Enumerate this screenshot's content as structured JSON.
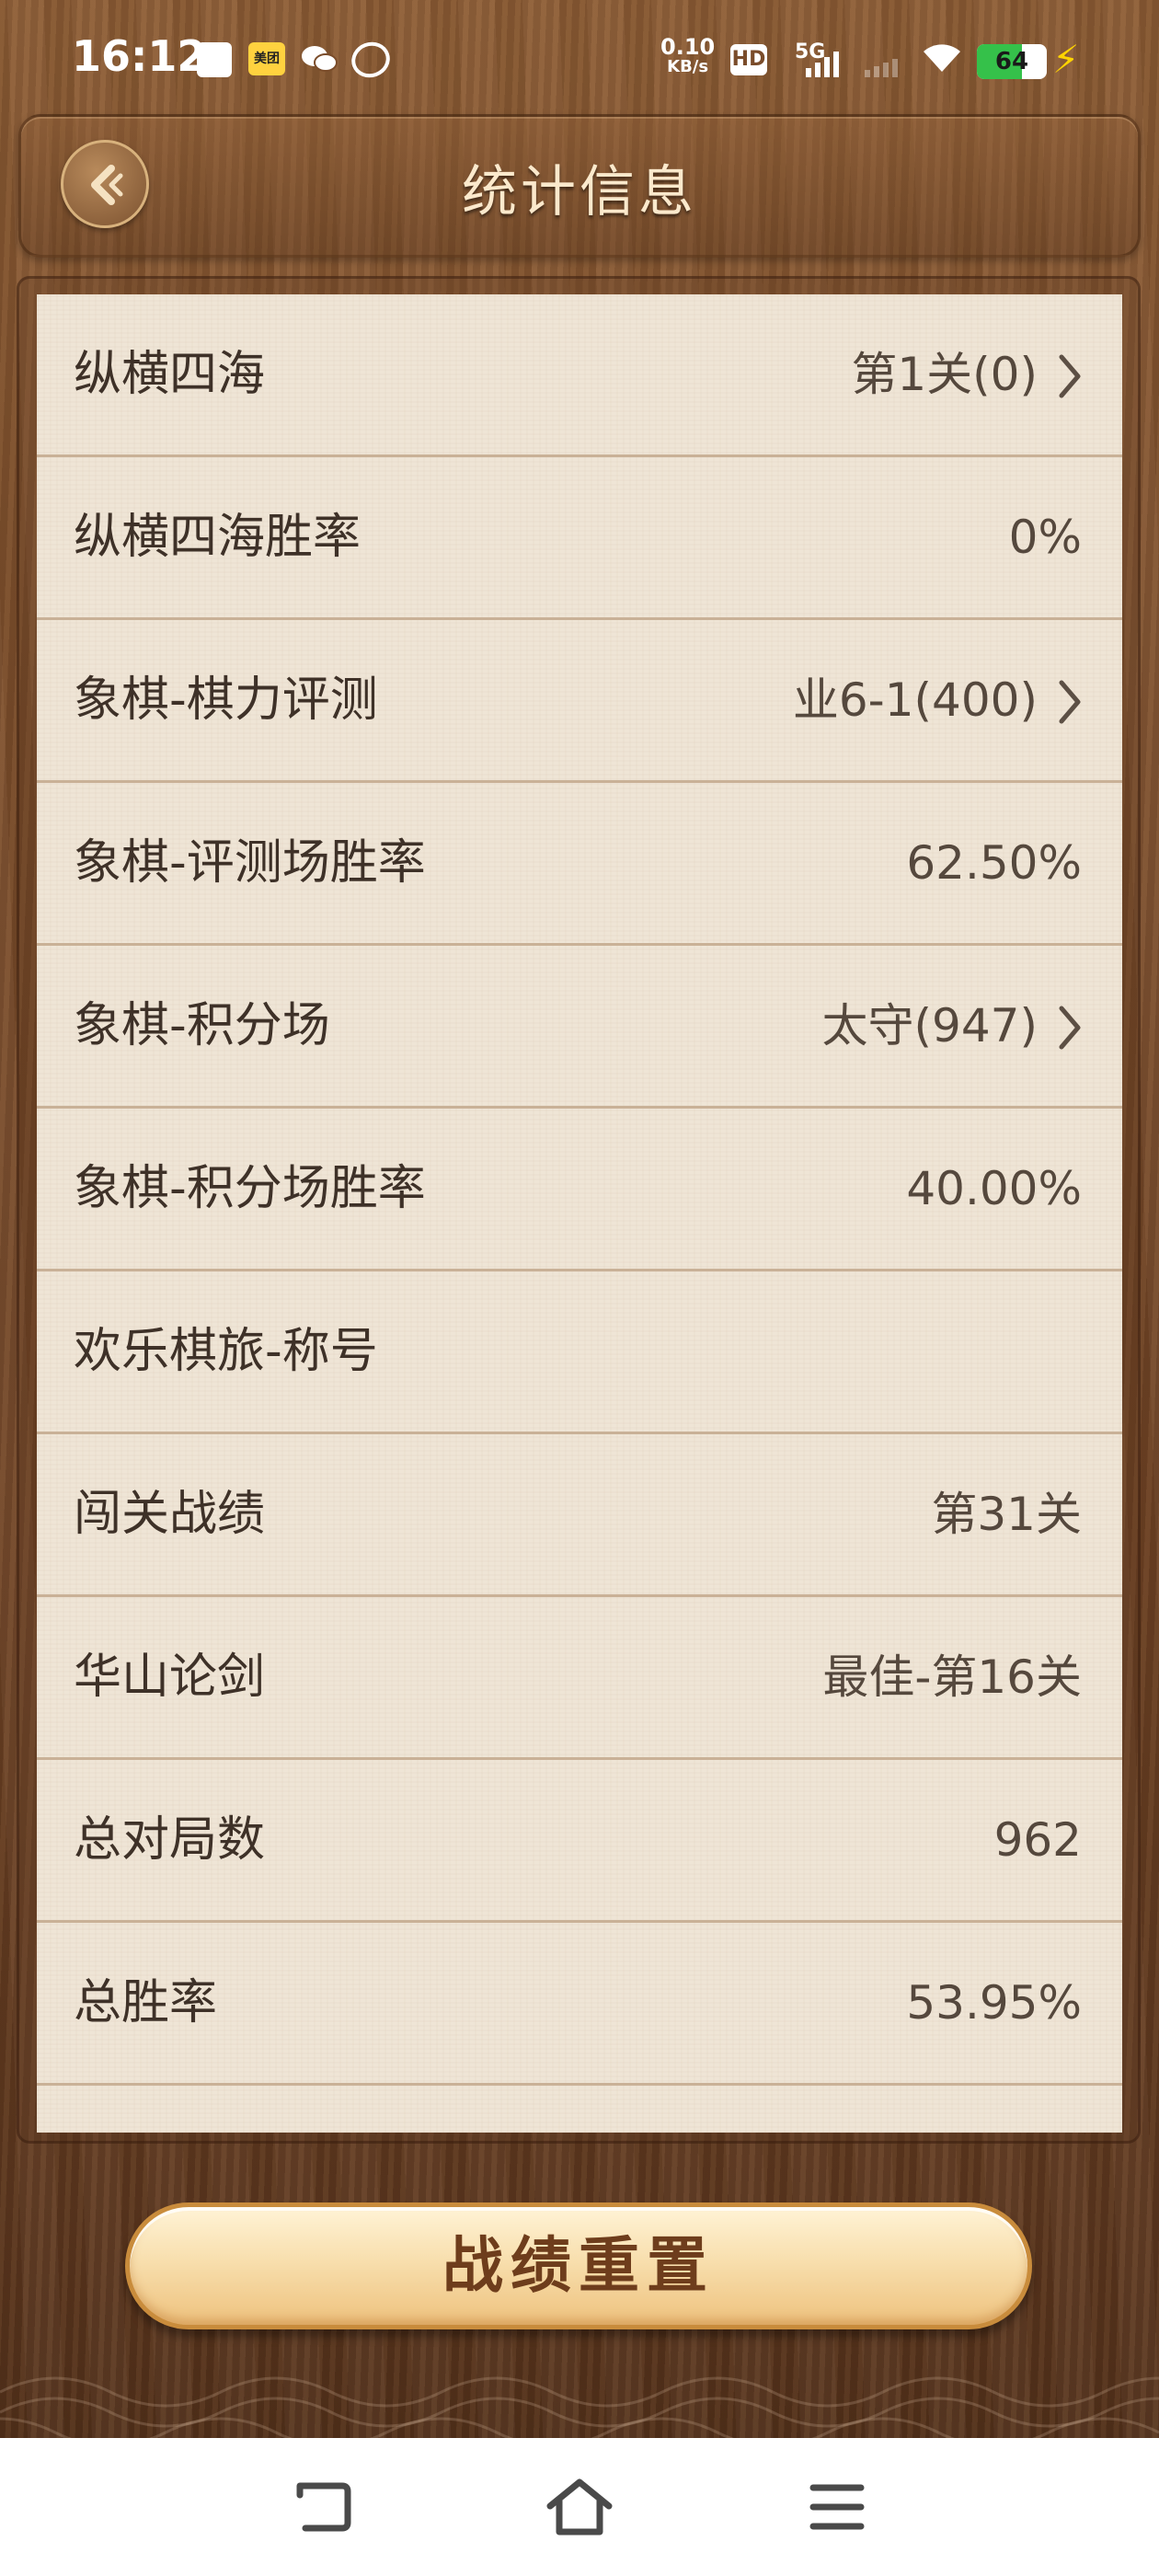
{
  "status_bar": {
    "time": "16:12",
    "net_speed_value": "0.10",
    "net_speed_unit": "KB/s",
    "hd_label": "HD",
    "network_type": "5G",
    "battery_level": "64",
    "battery_fraction": 0.64,
    "app_icons": [
      "white-square-icon",
      "meituan-icon",
      "wechat-icon",
      "browser-icon"
    ],
    "meituan_label": "美团"
  },
  "header": {
    "title": "统计信息",
    "back_icon": "back-arrow-icon"
  },
  "stats": [
    {
      "label": "纵横四海",
      "value": "第1关(0)",
      "has_arrow": true
    },
    {
      "label": "纵横四海胜率",
      "value": "0%",
      "has_arrow": false
    },
    {
      "label": "象棋-棋力评测",
      "value": "业6-1(400)",
      "has_arrow": true
    },
    {
      "label": "象棋-评测场胜率",
      "value": "62.50%",
      "has_arrow": false
    },
    {
      "label": "象棋-积分场",
      "value": "太守(947)",
      "has_arrow": true
    },
    {
      "label": "象棋-积分场胜率",
      "value": "40.00%",
      "has_arrow": false
    },
    {
      "label": "欢乐棋旅-称号",
      "value": "",
      "has_arrow": false
    },
    {
      "label": "闯关战绩",
      "value": "第31关",
      "has_arrow": false
    },
    {
      "label": "华山论剑",
      "value": "最佳-第16关",
      "has_arrow": false
    },
    {
      "label": "总对局数",
      "value": "962",
      "has_arrow": false
    },
    {
      "label": "总胜率",
      "value": "53.95%",
      "has_arrow": false
    }
  ],
  "reset_button": {
    "label": "战绩重置"
  },
  "nav_bar": {
    "icons": [
      "back-nav-icon",
      "home-icon",
      "menu-icon"
    ]
  },
  "colors": {
    "wood": "#7a4c2a",
    "panel": "#efe5d6",
    "title_text": "#fbe9cc",
    "button_text": "#6e3d1c",
    "battery_fill": "#35c14a",
    "bolt": "#ffd400"
  }
}
